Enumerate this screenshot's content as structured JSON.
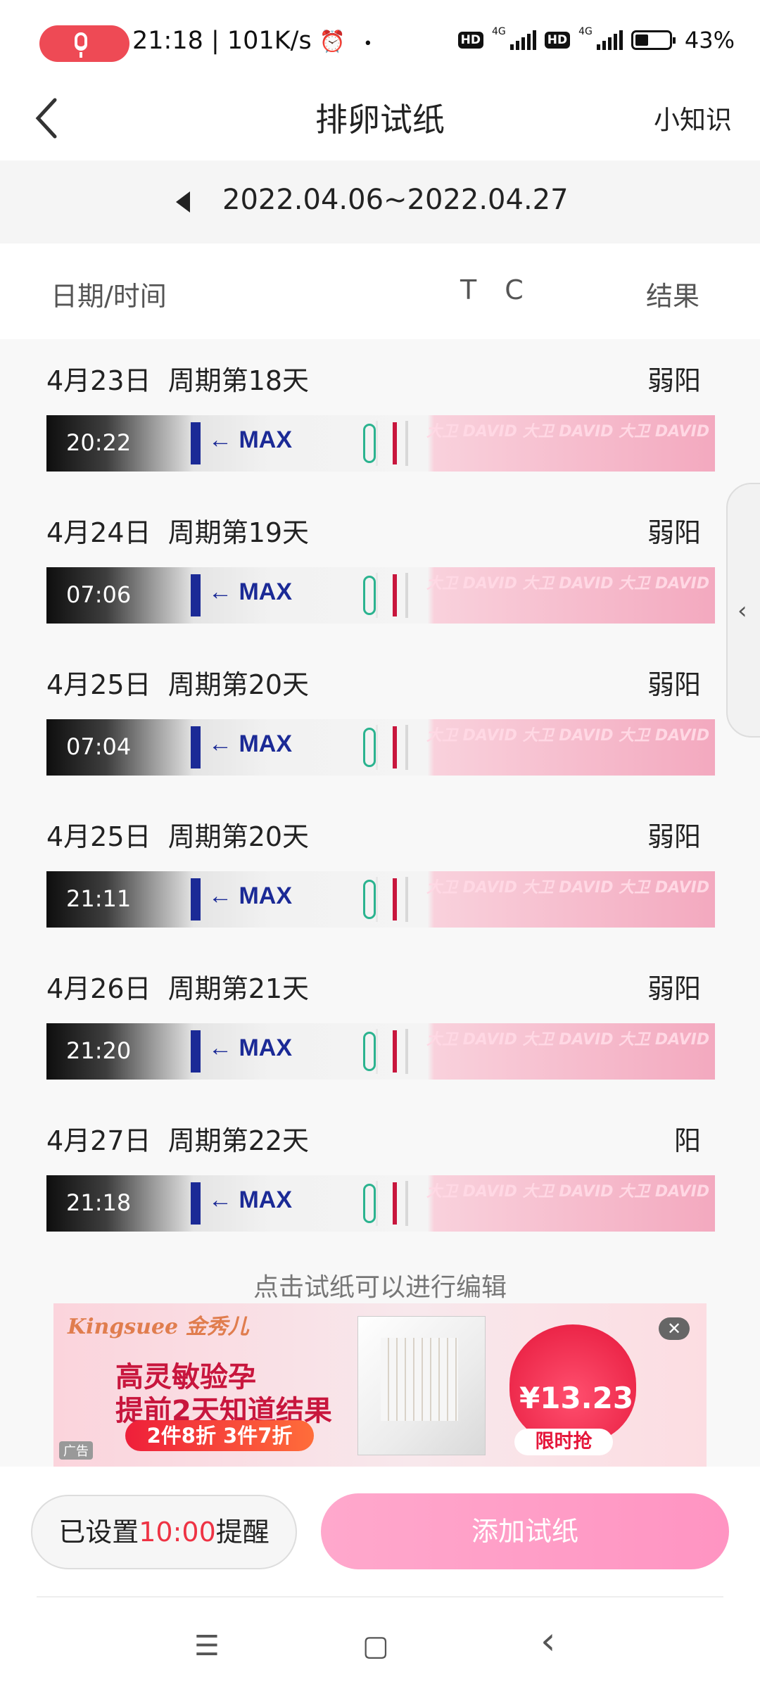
{
  "status_bar": {
    "time_and_speed": "21:18 | 101K/s",
    "dot": "•",
    "hd1": "HD",
    "net1": "4G",
    "hd2": "HD",
    "net2": "4G",
    "battery": "43%"
  },
  "header": {
    "title": "排卵试纸",
    "tips": "小知识",
    "back_icon": "chevron-left-icon"
  },
  "range": "2022.04.06~2022.04.27",
  "columns": {
    "date": "日期/时间",
    "tc": "T C",
    "result": "结果"
  },
  "records": [
    {
      "date": "4月23日",
      "cycle": "周期第18天",
      "result": "弱阳",
      "time": "20:22",
      "max": "← MAX"
    },
    {
      "date": "4月24日",
      "cycle": "周期第19天",
      "result": "弱阳",
      "time": "07:06",
      "max": "← MAX"
    },
    {
      "date": "4月25日",
      "cycle": "周期第20天",
      "result": "弱阳",
      "time": "07:04",
      "max": "← MAX"
    },
    {
      "date": "4月25日",
      "cycle": "周期第20天",
      "result": "弱阳",
      "time": "21:11",
      "max": "← MAX"
    },
    {
      "date": "4月26日",
      "cycle": "周期第21天",
      "result": "弱阳",
      "time": "21:20",
      "max": "← MAX"
    },
    {
      "date": "4月27日",
      "cycle": "周期第22天",
      "result": "阳",
      "time": "21:18",
      "max": "← MAX"
    }
  ],
  "strip_brand_text": "大卫 DAVID 大卫 DAVID 大卫 DAVID",
  "hint": "点击试纸可以进行编辑",
  "ad": {
    "brand": "Kingsuee 金秀儿",
    "line1": "高灵敏验孕",
    "line2": "提前2天知道结果",
    "promo": "2件8折 3件7折",
    "price": "¥13.23",
    "rush": "限时抢",
    "close": "✕",
    "label": "广告"
  },
  "bottom": {
    "reminder_prefix": "已设置",
    "reminder_time": "10:00",
    "reminder_suffix": "提醒",
    "add_button": "添加试纸"
  },
  "nav": {
    "menu": "☰",
    "home": "▢",
    "back": "‹"
  }
}
